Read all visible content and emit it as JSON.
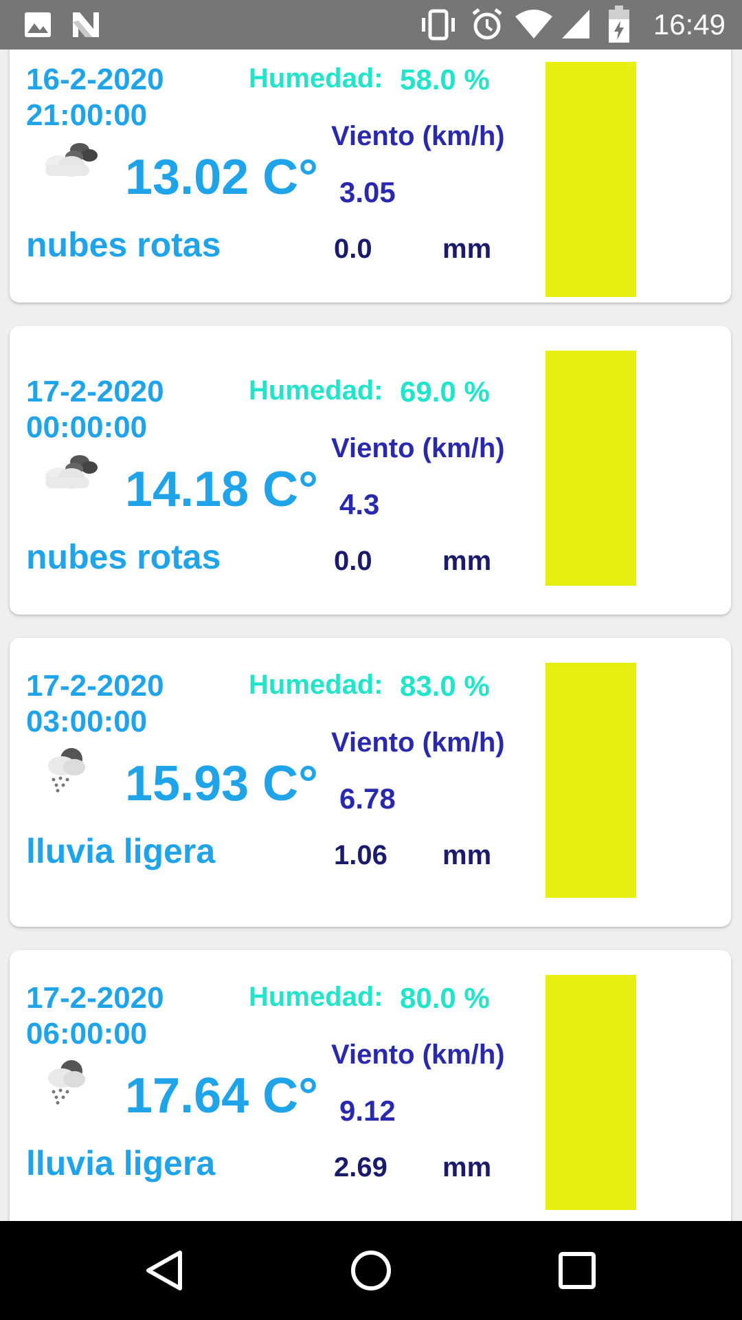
{
  "status_bar": {
    "time": "16:49",
    "icons": [
      "image-icon",
      "n-icon",
      "vibrate-icon",
      "alarm-icon",
      "wifi-icon",
      "signal-icon",
      "battery-charging-icon"
    ]
  },
  "colors": {
    "date": "#1fa4ea",
    "humidity": "#20e5cb",
    "wind": "#2929b0",
    "rain": "#1b1b6e",
    "bar": "#e6ef0f"
  },
  "forecast": [
    {
      "date": "16-2-2020",
      "time": "21:00:00",
      "humidity_label": "Humedad:",
      "humidity_value": "58.0 %",
      "wind_label": "Viento (km/h)",
      "wind_value": "3.05",
      "temperature": "13.02 C°",
      "description": "nubes rotas",
      "rain_value": "0.0",
      "rain_unit": "mm",
      "icon": "broken-clouds-icon"
    },
    {
      "date": "17-2-2020",
      "time": "00:00:00",
      "humidity_label": "Humedad:",
      "humidity_value": "69.0 %",
      "wind_label": "Viento (km/h)",
      "wind_value": "4.3",
      "temperature": "14.18 C°",
      "description": "nubes rotas",
      "rain_value": "0.0",
      "rain_unit": "mm",
      "icon": "broken-clouds-icon"
    },
    {
      "date": "17-2-2020",
      "time": "03:00:00",
      "humidity_label": "Humedad:",
      "humidity_value": "83.0 %",
      "wind_label": "Viento (km/h)",
      "wind_value": "6.78",
      "temperature": "15.93 C°",
      "description": "lluvia ligera",
      "rain_value": "1.06",
      "rain_unit": "mm",
      "icon": "light-rain-icon"
    },
    {
      "date": "17-2-2020",
      "time": "06:00:00",
      "humidity_label": "Humedad:",
      "humidity_value": "80.0 %",
      "wind_label": "Viento (km/h)",
      "wind_value": "9.12",
      "temperature": "17.64 C°",
      "description": "lluvia ligera",
      "rain_value": "2.69",
      "rain_unit": "mm",
      "icon": "light-rain-icon"
    }
  ],
  "nav_bar": [
    "back-icon",
    "home-icon",
    "recents-icon"
  ]
}
